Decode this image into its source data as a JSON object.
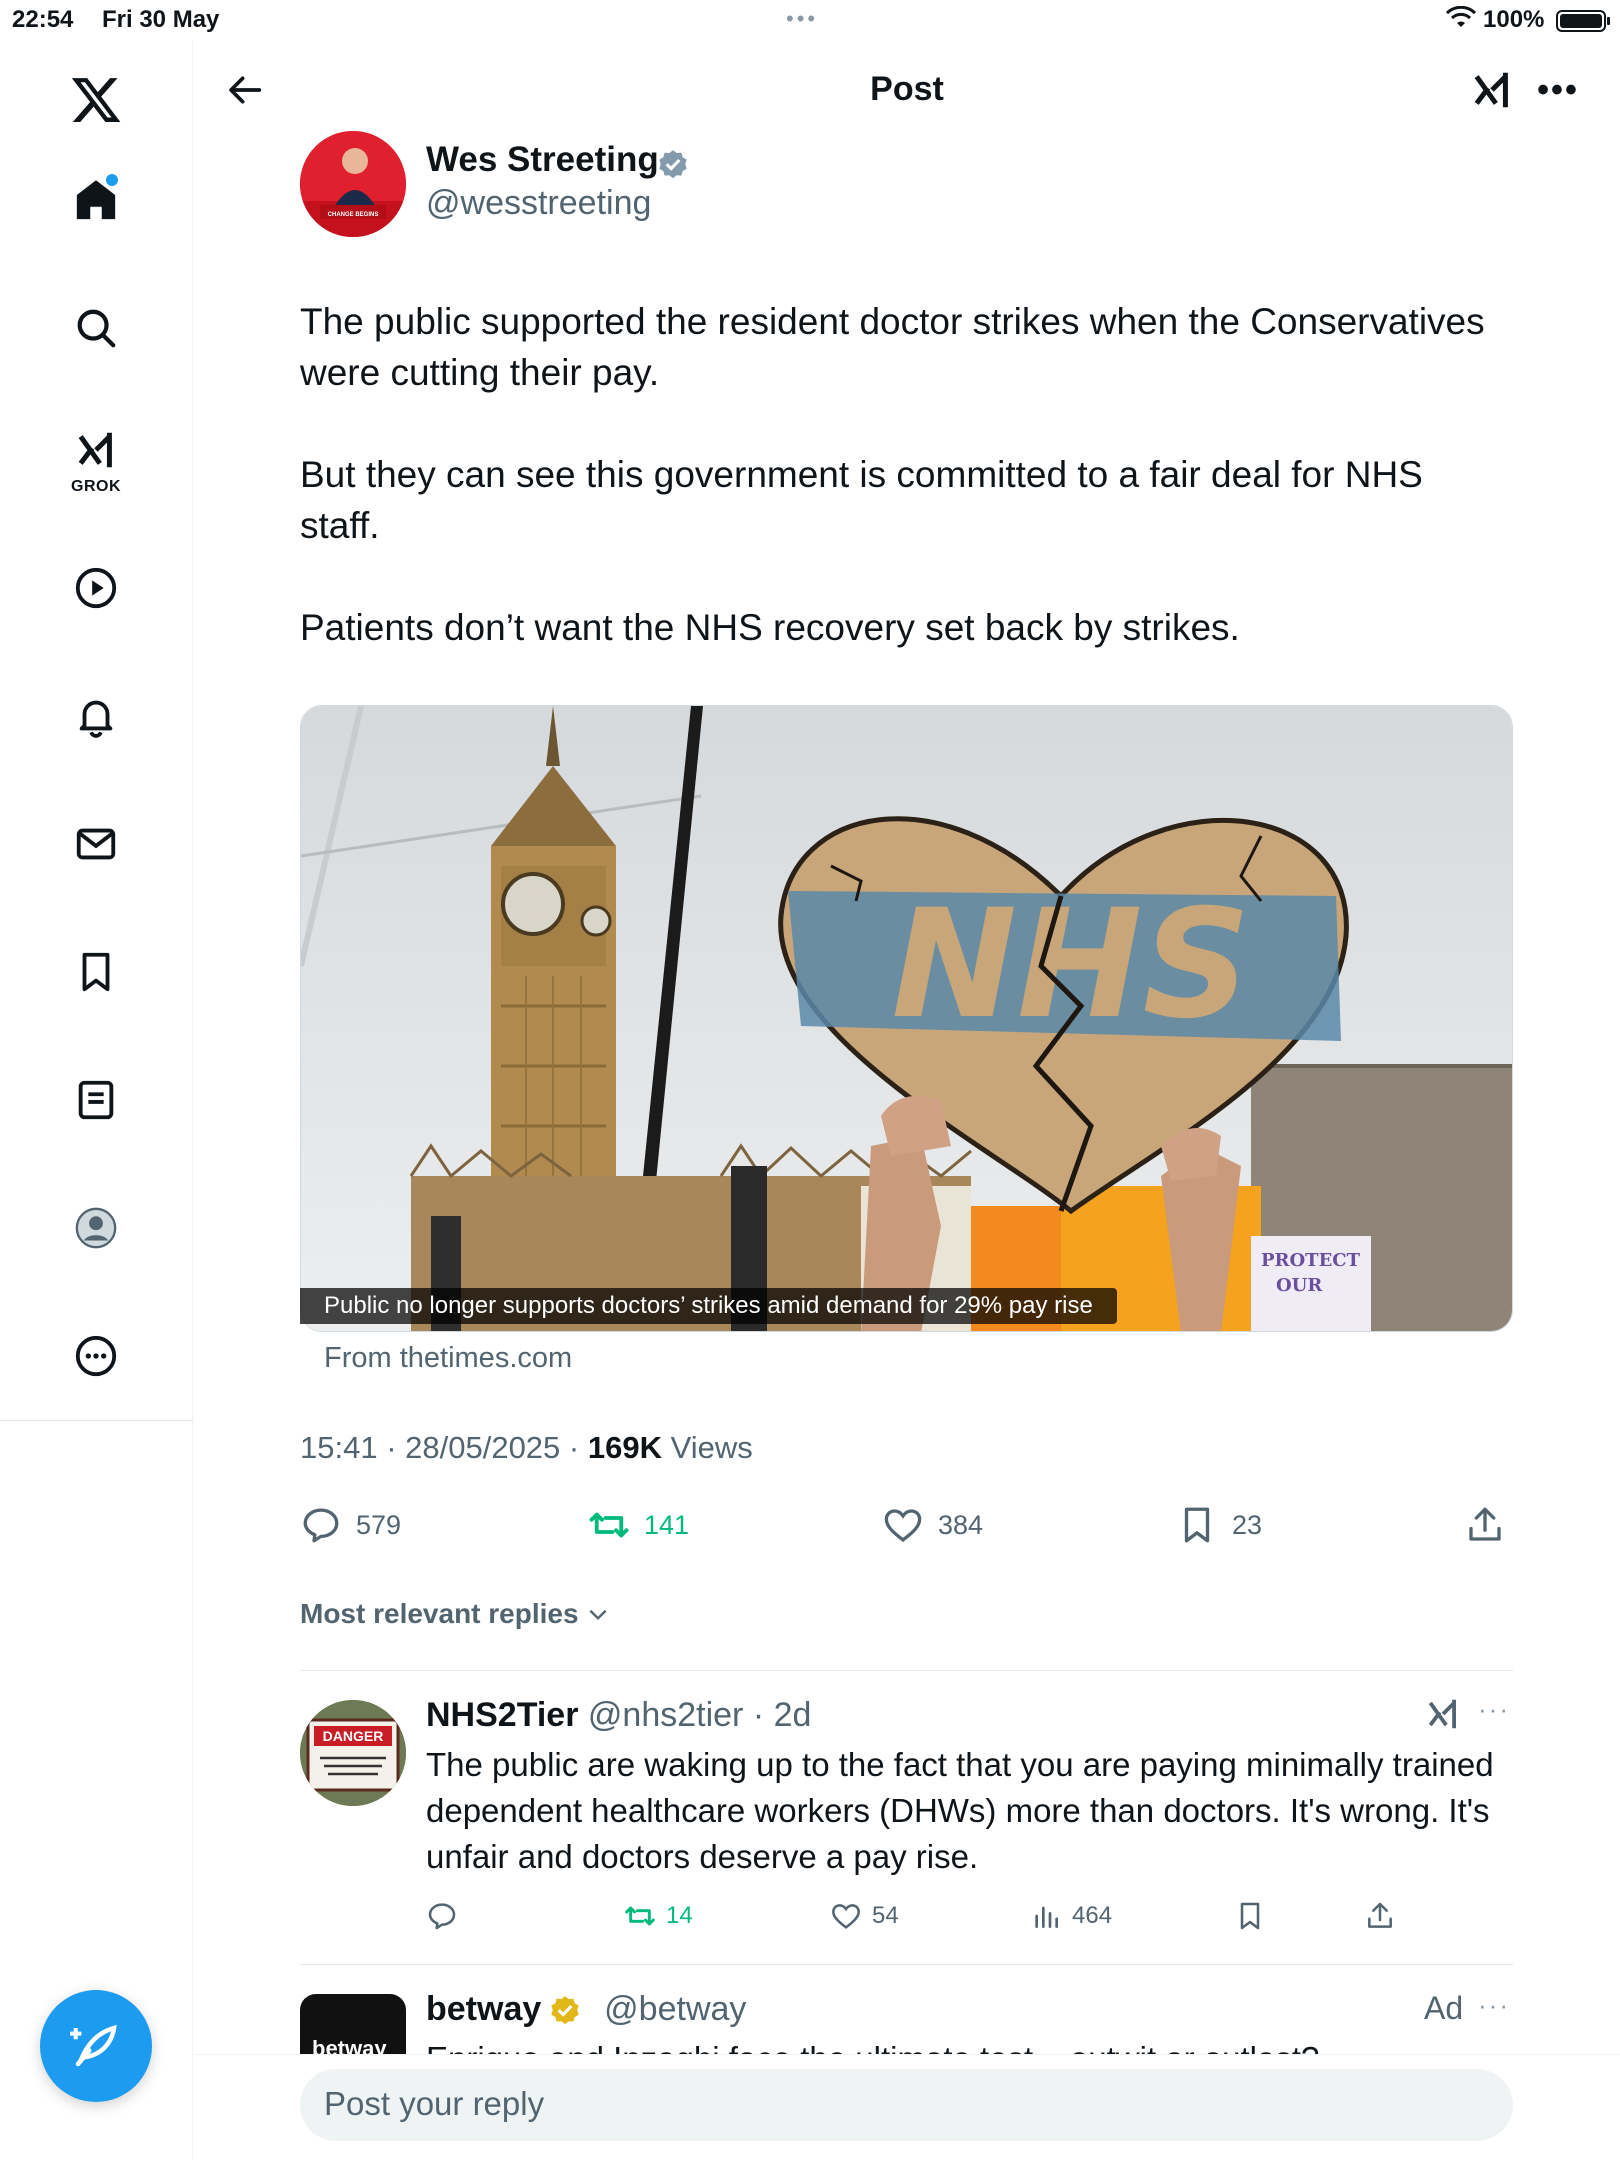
{
  "status_bar": {
    "time": "22:54",
    "date": "Fri 30 May",
    "multitask": "•••",
    "battery": "100%"
  },
  "sidebar": {
    "grok_label": "GROK",
    "items": [
      {
        "icon": "home-icon",
        "has_badge": true
      },
      {
        "icon": "search-icon"
      },
      {
        "icon": "grok-icon"
      },
      {
        "icon": "video-icon"
      },
      {
        "icon": "notifications-icon"
      },
      {
        "icon": "messages-icon"
      },
      {
        "icon": "bookmarks-icon"
      },
      {
        "icon": "lists-icon"
      },
      {
        "icon": "profile-icon"
      },
      {
        "icon": "more-icon"
      }
    ]
  },
  "header": {
    "title": "Post",
    "more": "•••"
  },
  "post": {
    "author_name": "Wes Streeting",
    "author_handle": "@wesstreeting",
    "verified": true,
    "paragraphs": [
      "The public supported the resident doctor strikes when the Conservatives were cutting their pay.",
      "But they can see this government is committed to a fair deal for NHS staff.",
      "Patients don’t want the NHS recovery set back by strikes."
    ],
    "link_card": {
      "caption": "Public no longer supports doctors’ strikes amid demand for 29% pay rise",
      "source": "From thetimes.com",
      "sign_text": "NHS"
    },
    "time": "15:41",
    "date": "28/05/2025",
    "views_count": "169K",
    "views_label": "Views",
    "replies": "579",
    "reposts": "141",
    "likes": "384",
    "bookmarks": "23"
  },
  "replies_sort": "Most relevant replies",
  "reply": {
    "name": "NHS2Tier",
    "handle": "@nhs2tier",
    "age": "2d",
    "text": "The public are waking up to the fact that you are paying minimally trained dependent healthcare workers (DHWs) more than doctors. It's wrong. It's unfair and doctors deserve a pay rise.",
    "reposts": "14",
    "likes": "54",
    "views": "464",
    "avatar_sign": "DANGER"
  },
  "ad": {
    "name": "betway",
    "handle": "@betway",
    "label": "Ad",
    "avatar_text": "betway",
    "text": "Enrique and Inzaghi face the ultimate test – outwit or outlast?"
  },
  "composer": {
    "placeholder": "Post your reply"
  },
  "colors": {
    "accent": "#1d9bf0",
    "repost_green": "#00ba7c",
    "secondary_text": "#536471",
    "verified_gold": "#e2b719"
  }
}
